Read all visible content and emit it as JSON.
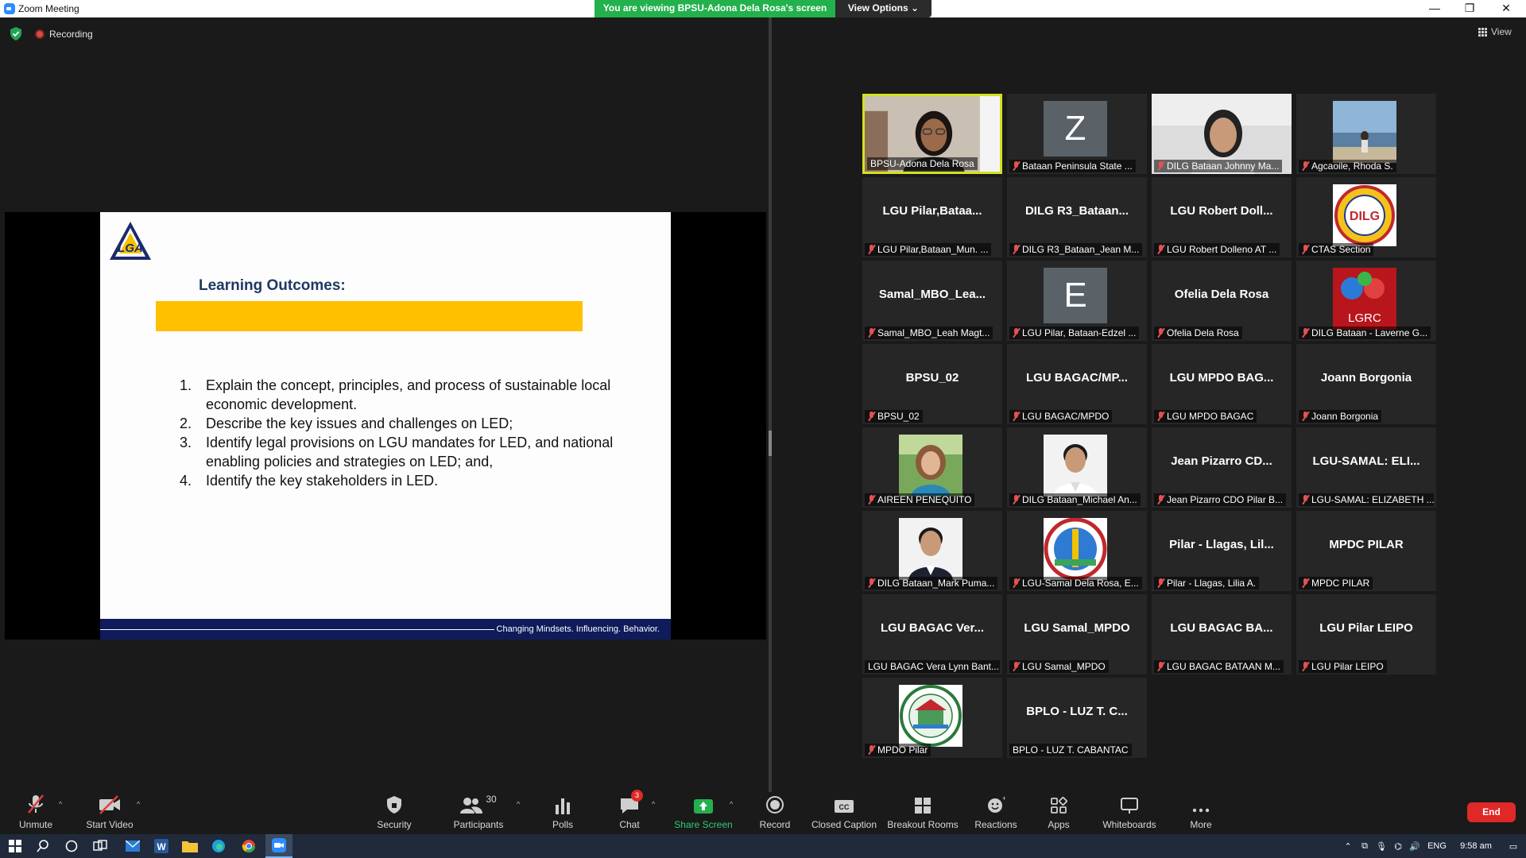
{
  "window": {
    "title": "Zoom Meeting",
    "viewing_banner": "You are viewing BPSU-Adona Dela Rosa's screen",
    "view_options": "View Options",
    "minimize": "—",
    "restore": "❐",
    "close": "✕"
  },
  "meeting": {
    "recording_label": "Recording",
    "view_label": "View"
  },
  "slide": {
    "heading": "Learning Outcomes:",
    "items": [
      {
        "num": "1.",
        "text": "Explain the concept, principles, and process of sustainable local economic development."
      },
      {
        "num": "2.",
        "text": "Describe the key issues and challenges on LED;"
      },
      {
        "num": "3.",
        "text": "Identify legal provisions on LGU mandates for LED, and national enabling policies and strategies on LED; and,"
      },
      {
        "num": "4.",
        "text": "Identify the key stakeholders in LED."
      }
    ],
    "footer_tagline": "Changing Mindsets. Influencing. Behavior."
  },
  "participants": [
    {
      "label": "BPSU-Adona Dela Rosa",
      "display": "",
      "kind": "video-woman",
      "muted": false,
      "active": true
    },
    {
      "label": "Bataan Peninsula State ...",
      "display": "Z",
      "kind": "letter",
      "muted": true
    },
    {
      "label": "DILG Bataan Johnny Ma...",
      "display": "",
      "kind": "video-man",
      "muted": true
    },
    {
      "label": "Agcaoile, Rhoda S.",
      "display": "",
      "kind": "photo-beach",
      "muted": true
    },
    {
      "label": "LGU Pilar,Bataan_Mun. ...",
      "display": "LGU Pilar,Bataa...",
      "kind": "text",
      "muted": true
    },
    {
      "label": "DILG R3_Bataan_Jean M...",
      "display": "DILG R3_Bataan...",
      "kind": "text",
      "muted": true
    },
    {
      "label": "LGU Robert Dolleno AT ...",
      "display": "LGU Robert Doll...",
      "kind": "text",
      "muted": true
    },
    {
      "label": "CTAS Section",
      "display": "",
      "kind": "logo-dilg",
      "muted": true,
      "logo_text": "DILG"
    },
    {
      "label": "Samal_MBO_Leah Magt...",
      "display": "Samal_MBO_Lea...",
      "kind": "text",
      "muted": true
    },
    {
      "label": "LGU Pilar, Bataan-Edzel ...",
      "display": "E",
      "kind": "letter",
      "muted": true
    },
    {
      "label": "Ofelia Dela Rosa",
      "display": "Ofelia Dela Rosa",
      "kind": "text",
      "muted": true
    },
    {
      "label": "DILG Bataan - Laverne G...",
      "display": "",
      "kind": "logo-lgrc",
      "muted": true,
      "logo_text": "LGRC"
    },
    {
      "label": "BPSU_02",
      "display": "BPSU_02",
      "kind": "text",
      "muted": true
    },
    {
      "label": "LGU BAGAC/MPDO",
      "display": "LGU BAGAC/MP...",
      "kind": "text",
      "muted": true
    },
    {
      "label": "LGU MPDO BAGAC",
      "display": "LGU MPDO BAG...",
      "kind": "text",
      "muted": true
    },
    {
      "label": "Joann Borgonia",
      "display": "Joann Borgonia",
      "kind": "text",
      "muted": true
    },
    {
      "label": "AIREEN PENEQUITO",
      "display": "",
      "kind": "photo-woman",
      "muted": true
    },
    {
      "label": "DILG Bataan_Michael An...",
      "display": "",
      "kind": "photo-man",
      "muted": true
    },
    {
      "label": "Jean Pizarro CDO Pilar B...",
      "display": "Jean Pizarro CD...",
      "kind": "text",
      "muted": true
    },
    {
      "label": "LGU-SAMAL: ELIZABETH ...",
      "display": "LGU-SAMAL: ELI...",
      "kind": "text",
      "muted": true
    },
    {
      "label": "DILG Bataan_Mark Puma...",
      "display": "",
      "kind": "photo-man2",
      "muted": true
    },
    {
      "label": "LGU-Samal Dela Rosa, E...",
      "display": "",
      "kind": "logo-samal",
      "muted": true
    },
    {
      "label": "Pilar - Llagas, Lilia A.",
      "display": "Pilar - Llagas, Lil...",
      "kind": "text",
      "muted": true
    },
    {
      "label": "MPDC PILAR",
      "display": "MPDC PILAR",
      "kind": "text",
      "muted": true
    },
    {
      "label": "LGU BAGAC Vera Lynn Bant...",
      "display": "LGU BAGAC Ver...",
      "kind": "text",
      "muted": false
    },
    {
      "label": "LGU Samal_MPDO",
      "display": "LGU Samal_MPDO",
      "kind": "text",
      "muted": true
    },
    {
      "label": "LGU BAGAC  BATAAN M...",
      "display": "LGU BAGAC  BA...",
      "kind": "text",
      "muted": true
    },
    {
      "label": "LGU Pilar LEIPO",
      "display": "LGU Pilar LEIPO",
      "kind": "text",
      "muted": true
    },
    {
      "label": "MPDO Pilar",
      "display": "",
      "kind": "logo-pilar",
      "muted": true
    },
    {
      "label": "BPLO - LUZ T. CABANTAC",
      "display": "BPLO - LUZ T. C...",
      "kind": "text",
      "muted": false
    }
  ],
  "toolbar": {
    "unmute": "Unmute",
    "start_video": "Start Video",
    "security": "Security",
    "participants": "Participants",
    "participants_count": "30",
    "polls": "Polls",
    "chat": "Chat",
    "chat_badge": "3",
    "share_screen": "Share Screen",
    "record": "Record",
    "closed_caption": "Closed Caption",
    "breakout_rooms": "Breakout Rooms",
    "reactions": "Reactions",
    "apps": "Apps",
    "whiteboards": "Whiteboards",
    "more": "More",
    "end": "End"
  },
  "taskbar": {
    "language": "ENG",
    "time": "9:58 am"
  },
  "colors": {
    "banner_green": "#22b14c",
    "end_red": "#e02828",
    "active_speaker": "#d4e21f",
    "slide_bar": "#ffc000",
    "slide_footer": "#0f1b5a"
  }
}
